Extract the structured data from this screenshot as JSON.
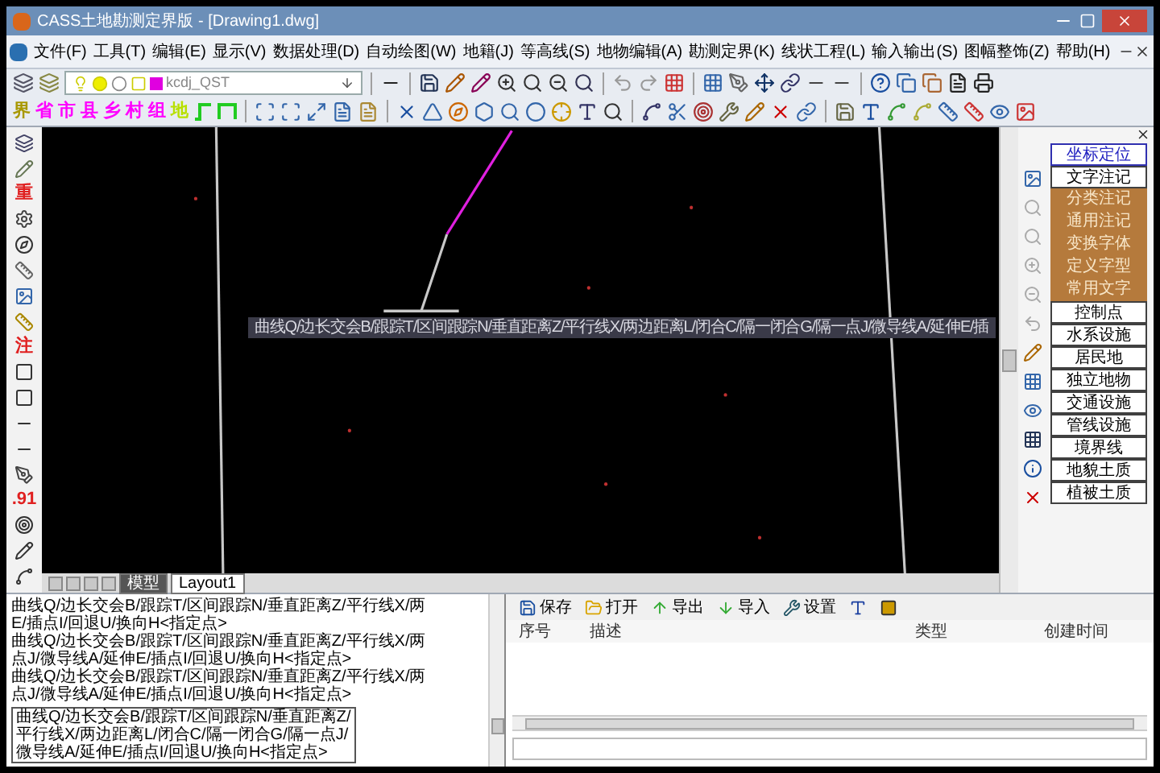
{
  "window": {
    "title": "CASS土地勘测定界版 - [Drawing1.dwg]"
  },
  "menu": [
    "文件(F)",
    "工具(T)",
    "编辑(E)",
    "显示(V)",
    "数据处理(D)",
    "自动绘图(W)",
    "地籍(J)",
    "等高线(S)",
    "地物编辑(A)",
    "勘测定界(K)",
    "线状工程(L)",
    "输入输出(S)",
    "图幅整饰(Z)",
    "帮助(H)"
  ],
  "layer_combo": {
    "value": "kcdj_QST"
  },
  "text_tools": [
    {
      "label": "界",
      "color": "#a89800"
    },
    {
      "label": "省",
      "color": "#ff00ff"
    },
    {
      "label": "市",
      "color": "#ff00ff"
    },
    {
      "label": "县",
      "color": "#ff00ff"
    },
    {
      "label": "乡",
      "color": "#ff00ff"
    },
    {
      "label": "村",
      "color": "#ff00ff"
    },
    {
      "label": "组",
      "color": "#ff00ff"
    },
    {
      "label": "地",
      "color": "#b8e000"
    }
  ],
  "left_toolbar": [
    {
      "label": "重"
    },
    {
      "label": "注"
    },
    {
      "label": ".91"
    }
  ],
  "drawing_tabs": [
    {
      "label": "模型",
      "selected": true
    },
    {
      "label": "Layout1",
      "selected": false
    }
  ],
  "tooltip": "曲线Q/边长交会B/跟踪T/区间跟踪N/垂直距离Z/平行线X/两边距离L/闭合C/隔一闭合G/隔一点J/微导线A/延伸E/插",
  "side_panel": {
    "items": [
      {
        "label": "坐标定位",
        "kind": "link"
      },
      {
        "label": "文字注记",
        "kind": "plain"
      },
      {
        "label": "分类注记",
        "kind": "category"
      },
      {
        "label": "通用注记",
        "kind": "category"
      },
      {
        "label": "变换字体",
        "kind": "category"
      },
      {
        "label": "定义字型",
        "kind": "category"
      },
      {
        "label": "常用文字",
        "kind": "category"
      },
      {
        "label": "控制点",
        "kind": "plain"
      },
      {
        "label": "水系设施",
        "kind": "plain"
      },
      {
        "label": "居民地",
        "kind": "plain"
      },
      {
        "label": "独立地物",
        "kind": "plain"
      },
      {
        "label": "交通设施",
        "kind": "plain"
      },
      {
        "label": "管线设施",
        "kind": "plain"
      },
      {
        "label": "境界线",
        "kind": "plain"
      },
      {
        "label": "地貌土质",
        "kind": "plain"
      },
      {
        "label": "植被土质",
        "kind": "plain"
      }
    ]
  },
  "command_history": [
    "曲线Q/边长交会B/跟踪T/区间跟踪N/垂直距离Z/平行线X/两",
    "E/插点I/回退U/换向H<指定点>",
    "曲线Q/边长交会B/跟踪T/区间跟踪N/垂直距离Z/平行线X/两",
    "点J/微导线A/延伸E/插点I/回退U/换向H<指定点>",
    "曲线Q/边长交会B/跟踪T/区间跟踪N/垂直距离Z/平行线X/两",
    "点J/微导线A/延伸E/插点I/回退U/换向H<指定点>"
  ],
  "command_prompt": [
    "曲线Q/边长交会B/跟踪T/区间跟踪N/垂直距离Z/",
    "平行线X/两边距离L/闭合C/隔一闭合G/隔一点J/",
    "微导线A/延伸E/插点I/回退U/换向H<指定点>"
  ],
  "attribute_panel": {
    "toolbar": [
      "保存",
      "打开",
      "导出",
      "导入",
      "设置"
    ],
    "columns": [
      "序号",
      "描述",
      "类型",
      "创建时间"
    ]
  }
}
